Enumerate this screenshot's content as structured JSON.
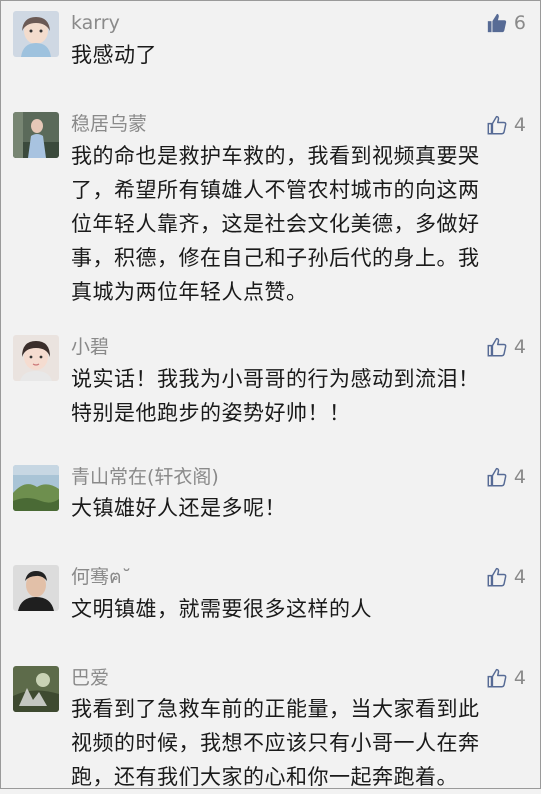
{
  "comments": [
    {
      "username": "karry",
      "likes": "6",
      "liked": true,
      "text": "我感动了"
    },
    {
      "username": "稳居乌蒙",
      "likes": "4",
      "liked": false,
      "text": "我的命也是救护车救的，我看到视频真要哭\n了，希望所有镇雄人不管农村城市的向这两\n位年轻人靠齐，这是社会文化美德，多做好\n事，积德，修在自己和子孙后代的身上。我\n真城为两位年轻人点赞。"
    },
    {
      "username": "小碧",
      "likes": "4",
      "liked": false,
      "text": "说实话！我我为小哥哥的行为感动到流泪！\n特别是他跑步的姿势好帅！！"
    },
    {
      "username": "青山常在(轩衣阁)",
      "likes": "4",
      "liked": false,
      "text": "大镇雄好人还是多呢！"
    },
    {
      "username": "何骞ฅ˘",
      "likes": "4",
      "liked": false,
      "text": "文明镇雄，就需要很多这样的人"
    },
    {
      "username": "巴爱",
      "likes": "4",
      "liked": false,
      "text": "我看到了急救车前的正能量，当大家看到此\n视频的时候，我想不应该只有小哥一人在奔\n跑，还有我们大家的心和你一起奔跑着。"
    }
  ],
  "colors": {
    "liked_icon": "#576b95",
    "unliked_icon": "#576b95",
    "username": "#8a8a8a",
    "text": "#1a1a1a",
    "background": "#f2f2f2"
  }
}
